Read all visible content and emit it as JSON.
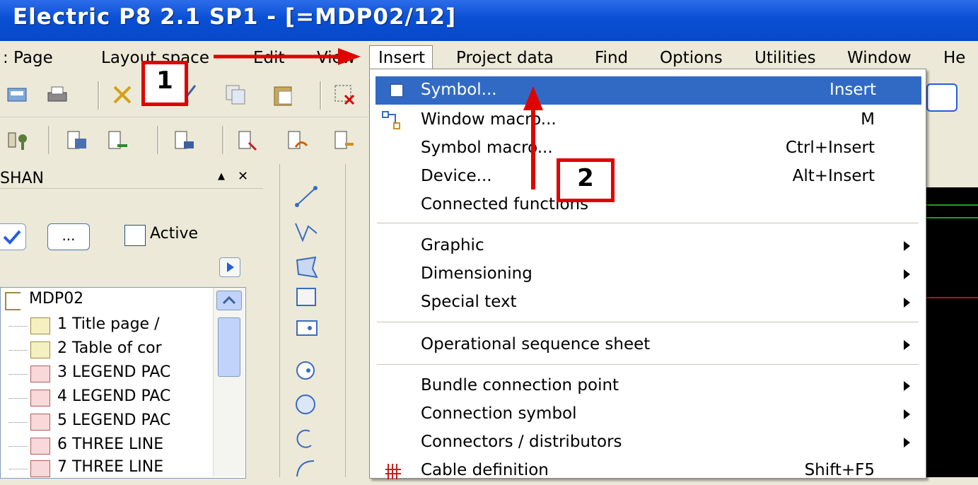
{
  "window": {
    "title": "Electric P8 2.1 SP1 - [=MDP02/12]"
  },
  "menubar": {
    "items": [
      {
        "label": ": Page"
      },
      {
        "label": "Layout space"
      },
      {
        "label": "Edit"
      },
      {
        "label": "View"
      },
      {
        "label": "Insert"
      },
      {
        "label": "Project data"
      },
      {
        "label": "Find"
      },
      {
        "label": "Options"
      },
      {
        "label": "Utilities"
      },
      {
        "label": "Window"
      },
      {
        "label": "He"
      }
    ]
  },
  "panel": {
    "title": "SHAN",
    "pin_glyph": "▲",
    "close_glyph": "✕",
    "browse_button": "...",
    "active_label": "Active",
    "tree": [
      {
        "label": "MDP02",
        "icon": "project-icon"
      },
      {
        "label": "1 Title page /",
        "icon": "table-page-icon"
      },
      {
        "label": "2 Table of cor",
        "icon": "table-page-icon"
      },
      {
        "label": "3 LEGEND PAC",
        "icon": "schematic-page-icon"
      },
      {
        "label": "4 LEGEND PAC",
        "icon": "schematic-page-icon"
      },
      {
        "label": "5 LEGEND PAC",
        "icon": "schematic-page-icon"
      },
      {
        "label": "6 THREE LINE",
        "icon": "schematic-page-icon"
      },
      {
        "label": "7 THREE LINE",
        "icon": "schematic-page-icon"
      }
    ]
  },
  "insert_menu": {
    "items": [
      {
        "label": "Symbol...",
        "shortcut": "Insert",
        "highlighted": true,
        "icon": "symbol-icon"
      },
      {
        "label": "Window macro...",
        "shortcut": "M",
        "icon": "window-macro-icon"
      },
      {
        "label": "Symbol macro...",
        "shortcut": "Ctrl+Insert"
      },
      {
        "label": "Device...",
        "shortcut": "Alt+Insert"
      },
      {
        "label": "Connected functions",
        "shortcut": ""
      },
      {
        "label": "Graphic",
        "submenu": true
      },
      {
        "label": "Dimensioning",
        "submenu": true
      },
      {
        "label": "Special text",
        "submenu": true
      },
      {
        "label": "Operational sequence sheet",
        "submenu": true
      },
      {
        "label": "Bundle connection point",
        "submenu": true
      },
      {
        "label": "Connection symbol",
        "submenu": true
      },
      {
        "label": "Connectors / distributors",
        "submenu": true
      },
      {
        "label": "Cable definition",
        "shortcut": "Shift+F5",
        "icon": "cable-icon"
      }
    ]
  },
  "annotations": {
    "step1": "1",
    "step2": "2",
    "color": "#e00000"
  }
}
